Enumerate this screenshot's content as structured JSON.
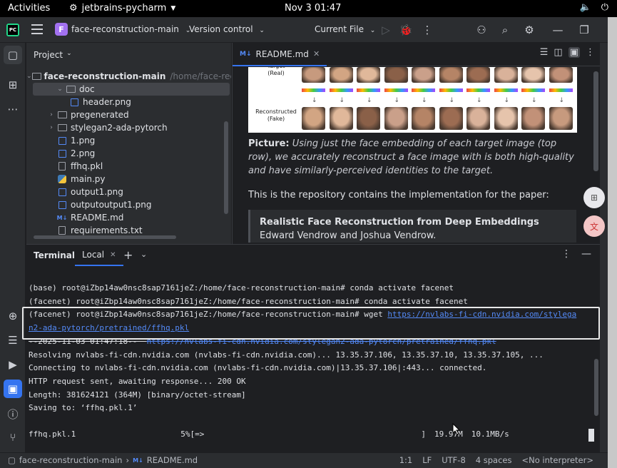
{
  "system_bar": {
    "activities": "Activities",
    "app_name": "jetbrains-pycharm",
    "clock": "Nov 3  01:47"
  },
  "titlebar": {
    "project_badge": "F",
    "project_name": "face-reconstruction-main",
    "vcs": "Version control",
    "run_config": "Current File"
  },
  "project_panel": {
    "title": "Project",
    "tree": [
      {
        "label": "face-reconstruction-main",
        "path": "/home/face-reconst",
        "type": "folder",
        "expanded": true,
        "indent": 0
      },
      {
        "label": "doc",
        "type": "folder",
        "expanded": true,
        "indent": 1,
        "selected": true
      },
      {
        "label": "header.png",
        "type": "image",
        "indent": 2
      },
      {
        "label": "pregenerated",
        "type": "folder",
        "expanded": false,
        "indent": 1
      },
      {
        "label": "stylegan2-ada-pytorch",
        "type": "folder",
        "expanded": false,
        "indent": 1
      },
      {
        "label": "1.png",
        "type": "image",
        "indent": 1
      },
      {
        "label": "2.png",
        "type": "image",
        "indent": 1
      },
      {
        "label": "ffhq.pkl",
        "type": "pkl",
        "indent": 1
      },
      {
        "label": "main.py",
        "type": "python",
        "indent": 1
      },
      {
        "label": "output1.png",
        "type": "image",
        "indent": 1
      },
      {
        "label": "outputoutput1.png",
        "type": "image",
        "indent": 1
      },
      {
        "label": "README.md",
        "type": "markdown",
        "indent": 1
      },
      {
        "label": "requirements.txt",
        "type": "text",
        "indent": 1
      }
    ]
  },
  "editor": {
    "tab_label": "README.md",
    "tab_icon": "M↓",
    "figure": {
      "top_label": "Target\n(Real)",
      "bottom_label": "Reconstructed\n(Fake)"
    },
    "caption_bold": "Picture:",
    "caption_text": " Using just the face embedding of each target image (top row), we accurately reconstruct a face image with is both high-quality and have similarly-perceived identities to the target.",
    "paragraph": "This is the repository contains the implementation for the paper:",
    "quote_title": "Realistic Face Reconstruction from Deep Embeddings",
    "quote_authors": "Edward Vendrow and Joshua Vendrow."
  },
  "terminal": {
    "title": "Terminal",
    "tab_label": "Local",
    "lines": [
      {
        "text": "(base) root@iZbp14aw0nsc8sap7161jeZ:/home/face-reconstruction-main# conda activate facenet"
      },
      {
        "text": "(facenet) root@iZbp14aw0nsc8sap7161jeZ:/home/face-reconstruction-main# conda activate facenet"
      },
      {
        "text": "(facenet) root@iZbp14aw0nsc8sap7161jeZ:/home/face-reconstruction-main# wget ",
        "link": "https://nvlabs-fi-cdn.nvidia.com/stylega"
      },
      {
        "text": "",
        "link": "n2-ada-pytorch/pretrained/ffhq.pkl"
      },
      {
        "text": "--2025-11-03 01:47:18--  ",
        "link": "https://nvlabs-fi-cdn.nvidia.com/stylegan2-ada-pytorch/pretrained/ffhq.pkl"
      },
      {
        "text": "Resolving nvlabs-fi-cdn.nvidia.com (nvlabs-fi-cdn.nvidia.com)... 13.35.37.106, 13.35.37.10, 13.35.37.105, ..."
      },
      {
        "text": "Connecting to nvlabs-fi-cdn.nvidia.com (nvlabs-fi-cdn.nvidia.com)|13.35.37.106|:443... connected."
      },
      {
        "text": "HTTP request sent, awaiting response... 200 OK"
      },
      {
        "text": "Length: 381624121 (364M) [binary/octet-stream]"
      },
      {
        "text": "Saving to: ‘ffhq.pkl.1’"
      }
    ],
    "progress": {
      "file": "ffhq.pkl.1",
      "percent": "5%[=>",
      "bracket": "]",
      "received": "19.97M",
      "speed": "10.1MB/s"
    }
  },
  "status_bar": {
    "breadcrumb_root": "face-reconstruction-main",
    "breadcrumb_file": "README.md",
    "position": "1:1",
    "line_sep": "LF",
    "encoding": "UTF-8",
    "indent": "4 spaces",
    "interpreter": "<No interpreter>"
  },
  "colors": {
    "accent": "#3574f0",
    "project_badge": "#a271f0",
    "link": "#548af7"
  }
}
